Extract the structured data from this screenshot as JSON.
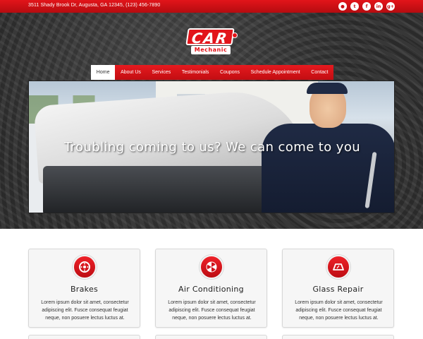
{
  "topbar": {
    "address": "3511 Shady Brook Dr, Augusta, GA 12345, (123) 456-7890",
    "social": [
      {
        "icon": "rss-icon",
        "glyph": "●"
      },
      {
        "icon": "twitter-icon",
        "glyph": "t"
      },
      {
        "icon": "facebook-icon",
        "glyph": "f"
      },
      {
        "icon": "linkedin-icon",
        "glyph": "in"
      },
      {
        "icon": "googleplus-icon",
        "glyph": "g+"
      }
    ]
  },
  "logo": {
    "title": "CAR",
    "subtitle": "Mechanic"
  },
  "nav": {
    "items": [
      "Home",
      "About Us",
      "Services",
      "Testimonials",
      "Coupons",
      "Schedule Appointment",
      "Contact"
    ],
    "active": "Home"
  },
  "hero": {
    "caption": "Troubling coming to us? We can come to you"
  },
  "features": [
    {
      "title": "Brakes",
      "icon": "brake-disc-icon",
      "text": "Lorem ipsum dolor sit amet, consectetur adipiscing elit. Fusce consequat feugiat neque, non posuere lectus luctus at."
    },
    {
      "title": "Air Conditioning",
      "icon": "fan-icon",
      "text": "Lorem ipsum dolor sit amet, consectetur adipiscing elit. Fusce consequat feugiat neque, non posuere lectus luctus at."
    },
    {
      "title": "Glass Repair",
      "icon": "windshield-icon",
      "text": "Lorem ipsum dolor sit amet, consectetur adipiscing elit. Fusce consequat feugiat neque, non posuere lectus luctus at."
    }
  ],
  "colors": {
    "brand_red": "#e2141a",
    "dark_bg": "#333333"
  }
}
